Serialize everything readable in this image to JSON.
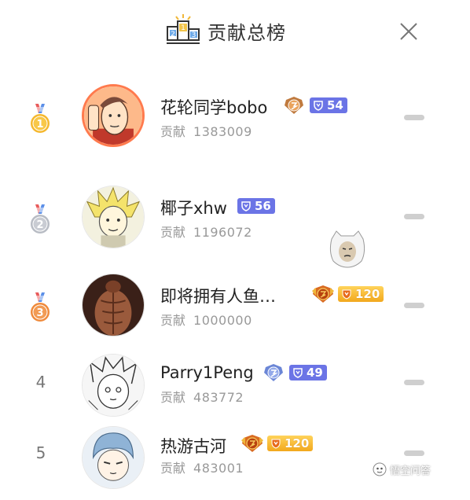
{
  "header": {
    "title": "贡献总榜",
    "podium_digits": [
      "2",
      "1",
      "3"
    ]
  },
  "rows": [
    {
      "rank": "1",
      "name": "花轮同学bobo",
      "contrib_label": "贡献",
      "contrib_value": "1383009",
      "level": "54",
      "level_style": "blue"
    },
    {
      "rank": "2",
      "name": "椰子xhw",
      "contrib_label": "贡献",
      "contrib_value": "1196072",
      "level": "56",
      "level_style": "blue"
    },
    {
      "rank": "3",
      "name": "即将拥有人鱼…",
      "contrib_label": "贡献",
      "contrib_value": "1000000",
      "level": "120",
      "level_style": "gold"
    },
    {
      "rank": "4",
      "name": "Parry1Peng",
      "contrib_label": "贡献",
      "contrib_value": "483772",
      "level": "49",
      "level_style": "blue"
    },
    {
      "rank": "5",
      "name": "热游古河",
      "contrib_label": "贡献",
      "contrib_value": "483001",
      "level": "120",
      "level_style": "gold"
    }
  ],
  "watermark": {
    "text": "悟空问答"
  },
  "colors": {
    "level_blue": "#6b74e6",
    "level_gold": "#f2a81d",
    "medal_gold": "#f5b82e",
    "medal_silver": "#b8bcc4",
    "medal_bronze": "#ef8a3c",
    "divider": "#cfcfcf"
  }
}
